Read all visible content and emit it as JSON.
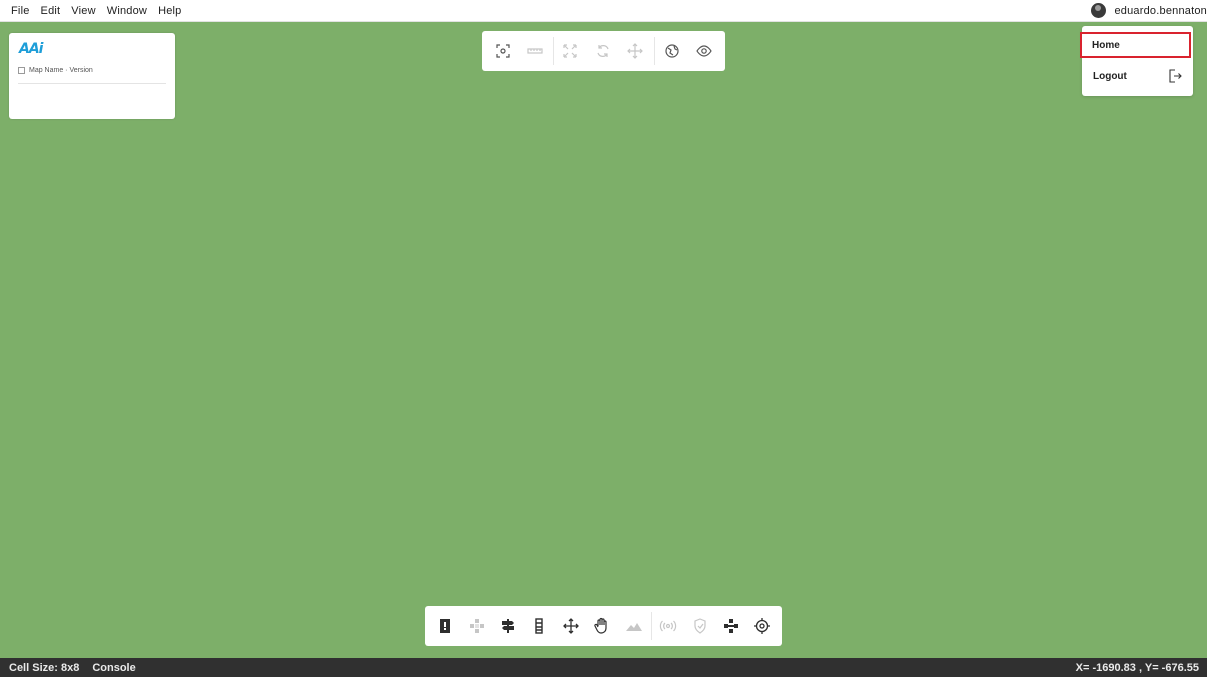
{
  "menubar": {
    "items": [
      "File",
      "Edit",
      "View",
      "Window",
      "Help"
    ],
    "username": "eduardo.bennaton"
  },
  "map_card": {
    "logo_text": "AAi",
    "map_name": "Map Name · Version"
  },
  "top_toolbar": {
    "icons": [
      "focus-icon",
      "ruler-icon",
      "expand-icon",
      "rotate-icon",
      "move-icon",
      "globe-icon",
      "eye-icon"
    ]
  },
  "user_menu": {
    "home_label": "Home",
    "logout_label": "Logout"
  },
  "bottom_toolbar": {
    "icons": [
      "door-icon",
      "cross-tiles-icon",
      "signpost-icon",
      "column-icon",
      "move-icon",
      "hand-icon",
      "mountain-icon",
      "broadcast-icon",
      "shield-icon",
      "route-icon",
      "target-icon"
    ]
  },
  "statusbar": {
    "cell_size": "Cell Size: 8x8",
    "console": "Console",
    "coords": "X= -1690.83 , Y= -676.55"
  },
  "colors": {
    "map_background": "#7daf69",
    "highlight": "#d9232e",
    "logo": "#1e9ed8",
    "statusbar": "#303030"
  }
}
